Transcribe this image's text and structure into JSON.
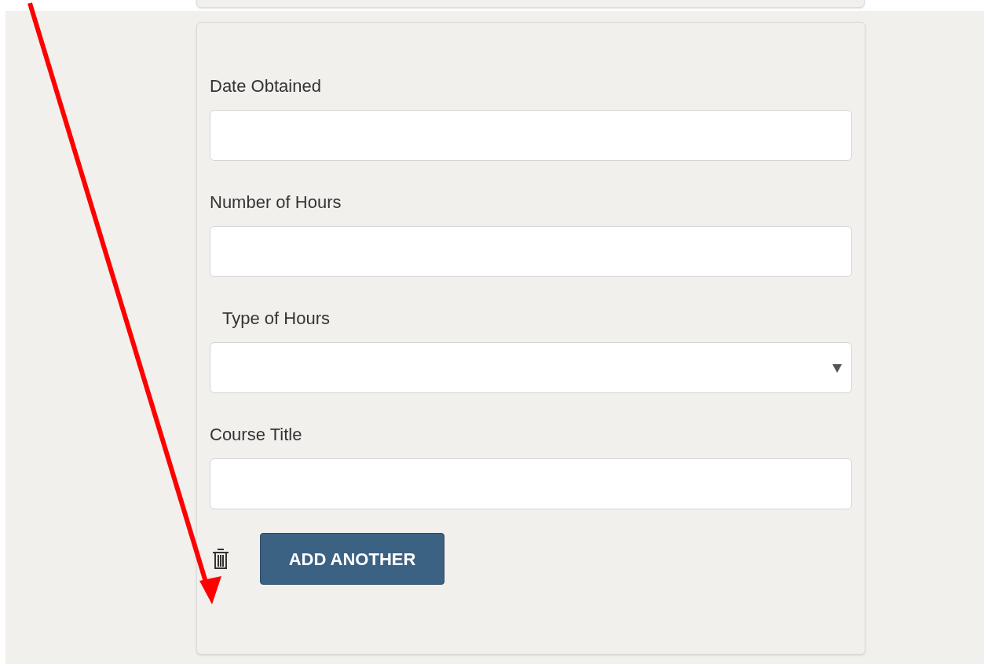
{
  "form": {
    "fields": [
      {
        "label": "Date Obtained",
        "kind": "text"
      },
      {
        "label": "Number of Hours",
        "kind": "text"
      },
      {
        "label": "Type of Hours",
        "kind": "select"
      },
      {
        "label": "Course Title",
        "kind": "text"
      }
    ],
    "add_button": "ADD ANOTHER"
  }
}
